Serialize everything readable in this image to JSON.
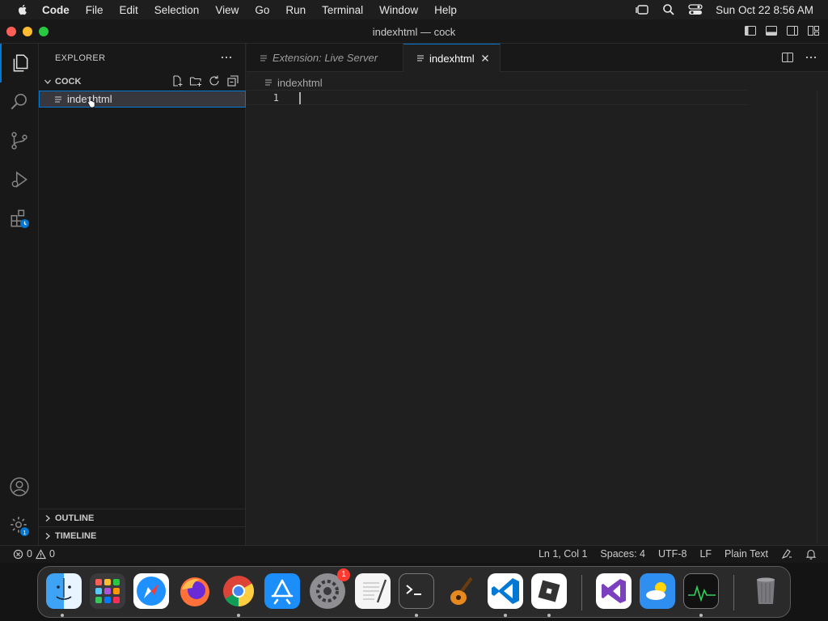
{
  "menubar": {
    "app_name": "Code",
    "menus": [
      "File",
      "Edit",
      "Selection",
      "View",
      "Go",
      "Run",
      "Terminal",
      "Window",
      "Help"
    ],
    "datetime": "Sun Oct 22  8:56 AM"
  },
  "window": {
    "title": "indexhtml — cock"
  },
  "sidebar": {
    "title": "EXPLORER",
    "folder": "COCK",
    "file": "indexhtml",
    "outline_label": "OUTLINE",
    "timeline_label": "TIMELINE"
  },
  "tabs": [
    {
      "label": "Extension: Live Server"
    },
    {
      "label": "indexhtml"
    }
  ],
  "editor": {
    "breadcrumb": "indexhtml",
    "line_number": "1"
  },
  "statusbar": {
    "errors": "0",
    "warnings": "0",
    "position": "Ln 1, Col 1",
    "spaces": "Spaces: 4",
    "encoding": "UTF-8",
    "eol": "LF",
    "language": "Plain Text"
  },
  "badges": {
    "settings_badge": "1",
    "system_settings_badge": "1"
  },
  "colors": {
    "accent": "#0078d4",
    "background": "#1f1f1f"
  }
}
